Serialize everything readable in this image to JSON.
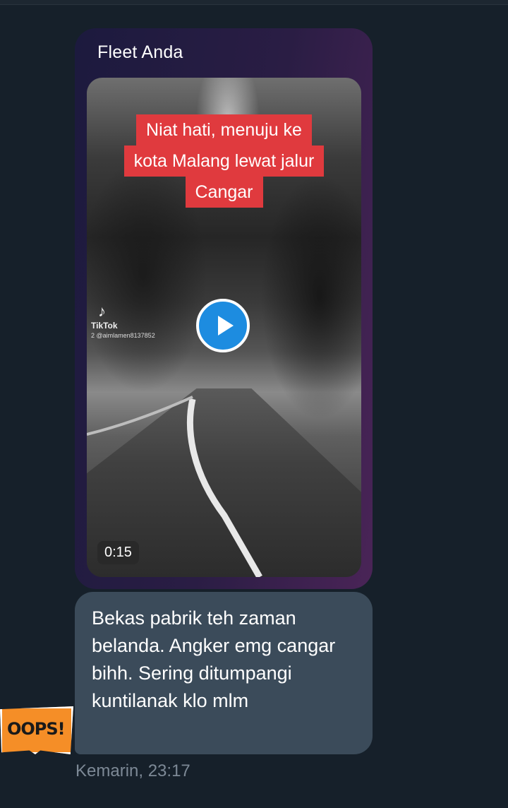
{
  "message": {
    "sender": "Fleet Anda",
    "video": {
      "caption_lines": [
        "Niat hati, menuju ke",
        "kota Malang lewat jalur",
        "Cangar"
      ],
      "watermark_brand": "TikTok",
      "watermark_user": "2 @aimlamen8137852",
      "duration": "0:15",
      "play_icon": "play-icon"
    },
    "text": "Bekas pabrik teh zaman belanda. Angker emg cangar bihh. Sering ditumpangi kuntilanak klo mlm",
    "timestamp": "Kemarin, 23:17"
  },
  "sticker": {
    "text": "OOPS!",
    "color": "#f58e27"
  },
  "colors": {
    "background": "#16202a",
    "fleet_gradient_start": "#1c1a3e",
    "fleet_gradient_end": "#4a2457",
    "bubble": "#3b4b5a",
    "caption_bg": "#e03a3e",
    "play_button": "#1d8ce0",
    "timestamp": "#7d8996"
  }
}
